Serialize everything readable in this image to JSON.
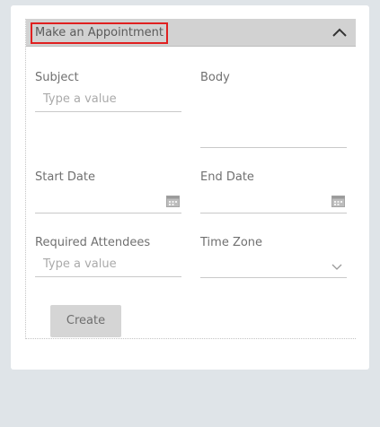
{
  "panel": {
    "title": "Make an Appointment",
    "collapse_icon": "chevron-up-icon"
  },
  "form": {
    "subject": {
      "label": "Subject",
      "placeholder": "Type a value"
    },
    "body": {
      "label": "Body"
    },
    "start_date": {
      "label": "Start Date",
      "icon": "calendar-icon"
    },
    "end_date": {
      "label": "End Date",
      "icon": "calendar-icon"
    },
    "required_attendees": {
      "label": "Required Attendees",
      "placeholder": "Type a value"
    },
    "time_zone": {
      "label": "Time Zone",
      "icon": "chevron-down-icon"
    }
  },
  "actions": {
    "create_label": "Create"
  },
  "colors": {
    "background": "#dfe4e8",
    "card": "#ffffff",
    "header": "#d2d2d2",
    "highlight_border": "#e02020",
    "button": "#d5d5d5"
  }
}
